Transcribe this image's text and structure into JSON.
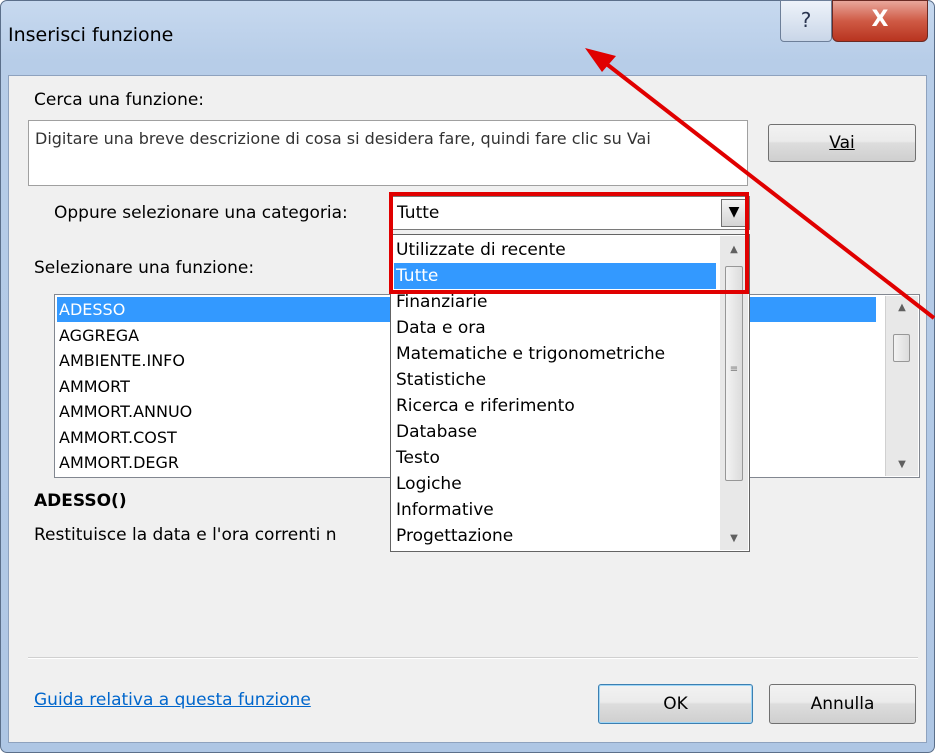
{
  "window": {
    "title": "Inserisci funzione",
    "help_glyph": "?",
    "close_glyph": "X"
  },
  "search": {
    "label": "Cerca una funzione:",
    "text": "Digitare una breve descrizione di cosa si desidera fare, quindi fare clic su Vai",
    "go_label": "Vai"
  },
  "category": {
    "label": "Oppure selezionare una categoria:",
    "selected": "Tutte",
    "options": [
      "Utilizzate di recente",
      "Tutte",
      "Finanziarie",
      "Data e ora",
      "Matematiche e trigonometriche",
      "Statistiche",
      "Ricerca e riferimento",
      "Database",
      "Testo",
      "Logiche",
      "Informative",
      "Progettazione"
    ],
    "highlighted_index": 1
  },
  "functions": {
    "label": "Selezionare una funzione:",
    "items": [
      "ADESSO",
      "AGGREGA",
      "AMBIENTE.INFO",
      "AMMORT",
      "AMMORT.ANNUO",
      "AMMORT.COST",
      "AMMORT.DEGR"
    ],
    "selected_index": 0
  },
  "details": {
    "signature": "ADESSO()",
    "description": "Restituisce la data e l'ora correnti n"
  },
  "footer": {
    "help_link": "Guida relativa a questa funzione",
    "ok_label": "OK",
    "cancel_label": "Annulla"
  },
  "colors": {
    "annotation": "#e00000",
    "selection": "#3399ff",
    "link": "#0066cc"
  }
}
